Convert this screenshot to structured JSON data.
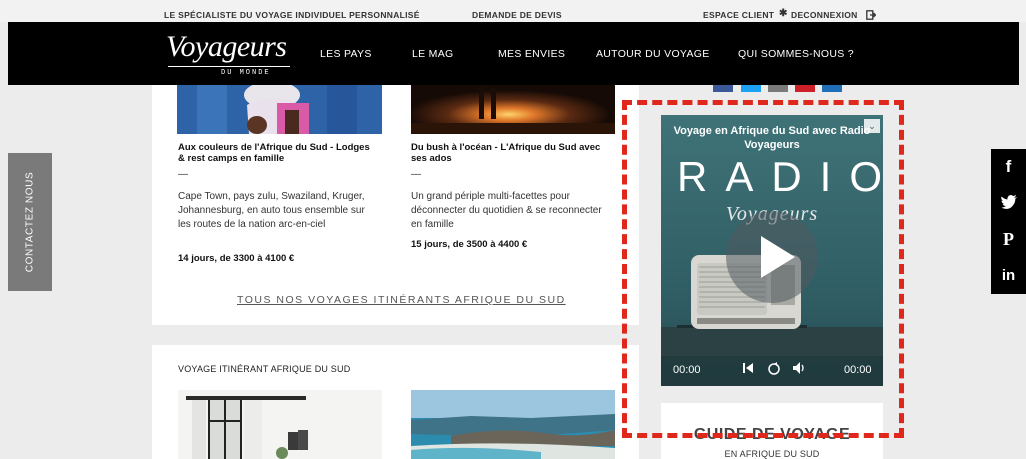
{
  "topbar": {
    "tagline": "LE SPÉCIALISTE DU VOYAGE INDIVIDUEL PERSONNALISÉ",
    "devis": "DEMANDE DE DEVIS",
    "client": "ESPACE CLIENT",
    "separator": "✱",
    "logout": "DECONNEXION"
  },
  "logo": {
    "main": "Voyageurs",
    "sub": "DU MONDE"
  },
  "nav": {
    "items": [
      "LES PAYS",
      "LE MAG",
      "MES ENVIES",
      "AUTOUR DU VOYAGE",
      "QUI SOMMES-NOUS ?"
    ]
  },
  "share_colors": [
    "#3b5998",
    "#1da1f2",
    "#7a7a7a",
    "#cb2027",
    "#1e6fb8"
  ],
  "trips": [
    {
      "title": "Aux couleurs de l'Afrique du Sud - Lodges & rest camps en famille",
      "dash": "—",
      "description": "Cape Town, pays zulu, Swaziland, Kruger, Johannesburg, en auto tous ensemble sur les routes de la nation arc-en-ciel",
      "price": "14 jours, de 3300 à 4100 €"
    },
    {
      "title": "Du bush à l'océan - L'Afrique du Sud avec ses ados",
      "dash": "—",
      "description": "Un grand périple multi-facettes pour déconnecter du quotidien & se reconnecter en famille",
      "price": "15 jours, de 3500 à 4400 €"
    }
  ],
  "all_link": "TOUS NOS VOYAGES ITINÉRANTS AFRIQUE DU SUD",
  "section2": {
    "title": "VOYAGE ITINÉRANT AFRIQUE DU SUD"
  },
  "radio": {
    "title": "Voyage en Afrique du Sud avec Radio Voyageurs",
    "word": "RADIO",
    "sub": "Voyageurs",
    "time_start": "00:00",
    "time_end": "00:00"
  },
  "guide": {
    "title": "GUIDE DE VOYAGE",
    "sub": "EN AFRIQUE DU SUD"
  },
  "contact": {
    "label": "CONTACTEZ NOUS"
  },
  "social": {
    "facebook": "f",
    "twitter": "🐦",
    "pinterest": "P",
    "linkedin": "in"
  },
  "highlight_color": "#e0271b"
}
